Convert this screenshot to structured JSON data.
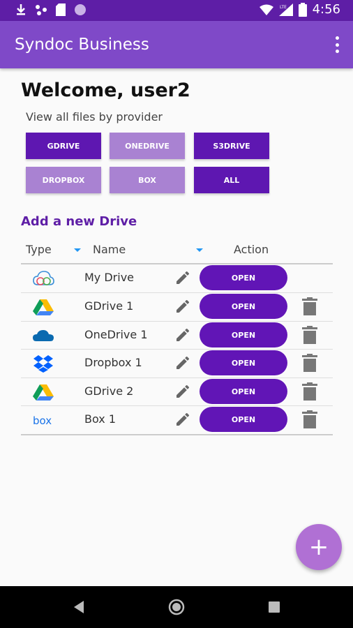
{
  "status_bar": {
    "time": "4:56",
    "network": "LTE"
  },
  "app_bar": {
    "title": "Syndoc Business"
  },
  "welcome": "Welcome, user2",
  "filter_label": "View all files by provider",
  "providers": [
    {
      "label": "GDRIVE",
      "active": true
    },
    {
      "label": "ONEDRIVE",
      "active": false
    },
    {
      "label": "S3DRIVE",
      "active": true
    },
    {
      "label": "DROPBOX",
      "active": false
    },
    {
      "label": "BOX",
      "active": false
    },
    {
      "label": "ALL",
      "active": true
    }
  ],
  "add_drive_label": "Add a new Drive",
  "table": {
    "headers": {
      "type": "Type",
      "name": "Name",
      "action": "Action"
    },
    "rows": [
      {
        "icon": "syndoc-cloud-icon",
        "name": "My Drive",
        "action": "OPEN",
        "deletable": false
      },
      {
        "icon": "google-drive-icon",
        "name": "GDrive 1",
        "action": "OPEN",
        "deletable": true
      },
      {
        "icon": "onedrive-icon",
        "name": "OneDrive 1",
        "action": "OPEN",
        "deletable": true
      },
      {
        "icon": "dropbox-icon",
        "name": "Dropbox 1",
        "action": "OPEN",
        "deletable": true
      },
      {
        "icon": "google-drive-icon",
        "name": "GDrive 2",
        "action": "OPEN",
        "deletable": true
      },
      {
        "icon": "box-icon",
        "name": "Box 1",
        "action": "OPEN",
        "deletable": true
      }
    ]
  },
  "fab_label": "+",
  "colors": {
    "primary": "#7f49c8",
    "primary_dark": "#5e1ea6",
    "button_dark": "#5e17b1",
    "button_light": "#a982d2",
    "fab": "#b070d4"
  }
}
